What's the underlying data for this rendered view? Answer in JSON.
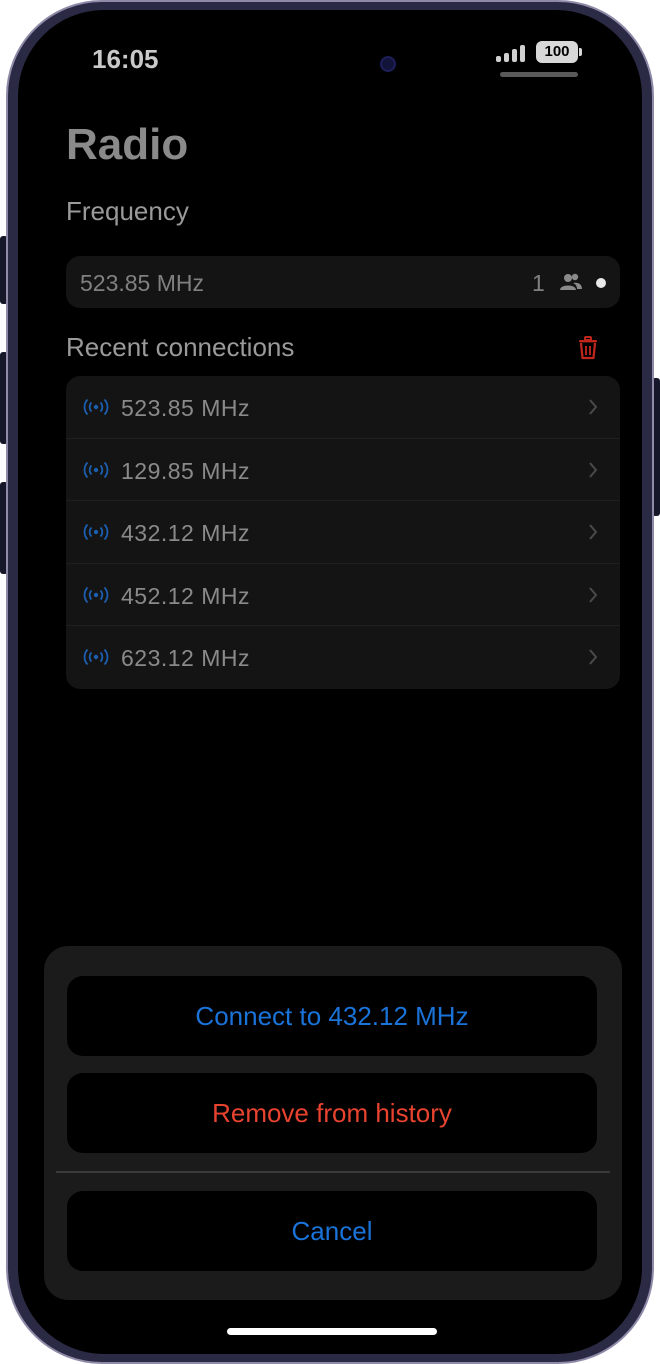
{
  "status_bar": {
    "time": "16:05",
    "battery": "100",
    "icons": [
      "camera-dot",
      "signal-bars-icon",
      "battery-icon"
    ]
  },
  "page": {
    "title": "Radio",
    "frequency_label": "Frequency",
    "frequency_value": "523.85 MHz",
    "listener_count": "1",
    "listener_icon": "users-icon",
    "recent_label": "Recent connections",
    "clear_icon": "trash-icon"
  },
  "recent": [
    {
      "label": "523.85 MHz",
      "icon": "radio-waves-icon"
    },
    {
      "label": "129.85 MHz",
      "icon": "radio-waves-icon"
    },
    {
      "label": "432.12 MHz",
      "icon": "radio-waves-icon"
    },
    {
      "label": "452.12 MHz",
      "icon": "radio-waves-icon"
    },
    {
      "label": "623.12 MHz",
      "icon": "radio-waves-icon"
    }
  ],
  "action_sheet": {
    "connect_label": "Connect to 432.12 MHz",
    "remove_label": "Remove from history",
    "cancel_label": "Cancel"
  },
  "colors": {
    "accent_blue": "#1a73d9",
    "danger_red": "#e8432f",
    "trash_red": "#c1261d",
    "icon_blue": "#1c5fb0",
    "background": "#000000",
    "surface": "#141414"
  }
}
